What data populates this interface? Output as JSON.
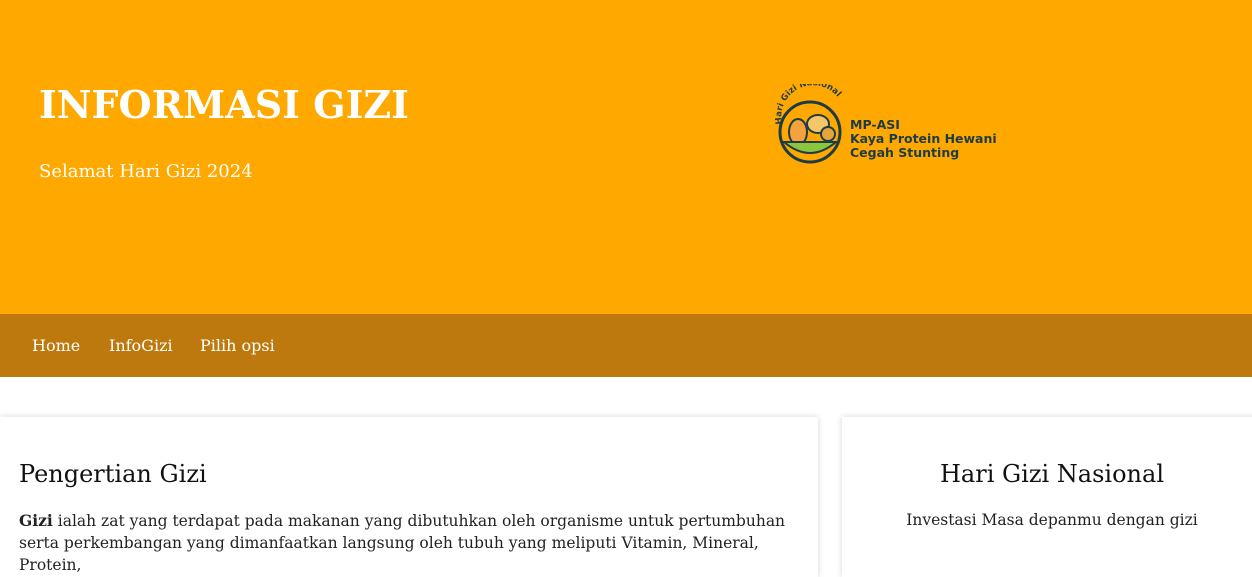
{
  "header": {
    "title": "INFORMASI GIZI",
    "subtitle": "Selamat Hari Gizi 2024",
    "logo": {
      "arc_text": "Hari Gizi Nasional",
      "lines": [
        "MP-ASI",
        "Kaya Protein Hewani",
        "Cegah Stunting"
      ]
    },
    "background": "#FFA800"
  },
  "nav": {
    "background": "#BE790E",
    "items": [
      "Home",
      "InfoGizi",
      "Pilih opsi"
    ]
  },
  "main_card": {
    "title": "Pengertian Gizi",
    "text_bold": "Gizi",
    "text": " ialah zat yang terdapat pada makanan yang dibutuhkan oleh organisme untuk pertumbuhan serta perkembangan yang dimanfaatkan langsung oleh tubuh yang meliputi Vitamin, Mineral, Protein,"
  },
  "side_card": {
    "title": "Hari Gizi Nasional",
    "text": "Investasi Masa depanmu dengan gizi"
  }
}
